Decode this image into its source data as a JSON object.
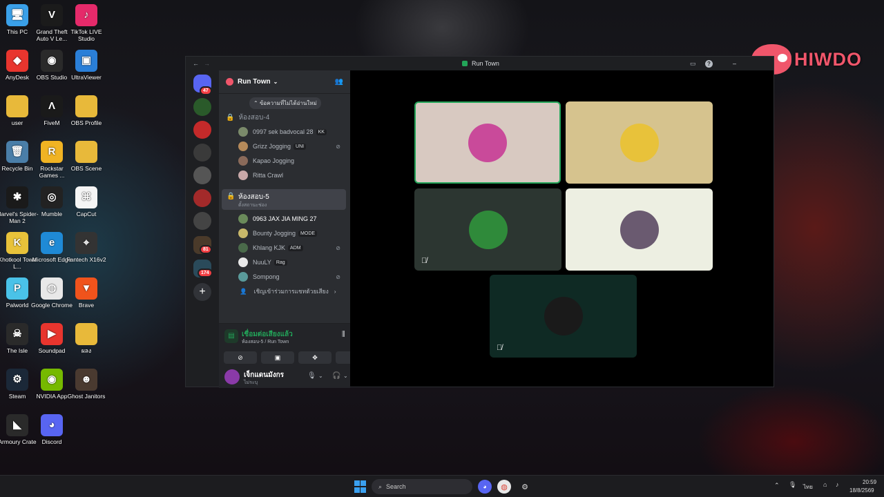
{
  "desktop": {
    "icons": [
      {
        "label": "This PC",
        "color": "#3aa0e8",
        "glyph": "🖥"
      },
      {
        "label": "Grand Theft Auto V Le...",
        "color": "#1b1b1b",
        "glyph": "V"
      },
      {
        "label": "TikTok LIVE Studio",
        "color": "#e52a6a",
        "glyph": "♪"
      },
      {
        "label": "AnyDesk",
        "color": "#e8352e",
        "glyph": "◆"
      },
      {
        "label": "OBS Studio",
        "color": "#2a2a2a",
        "glyph": "◉"
      },
      {
        "label": "UltraViewer",
        "color": "#2a7fd8",
        "glyph": "▣"
      },
      {
        "label": "user",
        "color": "#e8b93a",
        "glyph": ""
      },
      {
        "label": "FiveM",
        "color": "#1a1a1a",
        "glyph": "Λ"
      },
      {
        "label": "OBS Profile",
        "color": "#e8b93a",
        "glyph": ""
      },
      {
        "label": "Recycle Bin",
        "color": "#4a7ea8",
        "glyph": "🗑"
      },
      {
        "label": "Rockstar Games ...",
        "color": "#f0b323",
        "glyph": "R"
      },
      {
        "label": "OBS Scene",
        "color": "#e8b93a",
        "glyph": ""
      },
      {
        "label": "Marvel's Spider-Man 2",
        "color": "#1a1a1a",
        "glyph": "✱"
      },
      {
        "label": "Mumble",
        "color": "#222",
        "glyph": "◎"
      },
      {
        "label": "CapCut",
        "color": "#f5f5f5",
        "glyph": "⌘"
      },
      {
        "label": "Khotkool Town L...",
        "color": "#e8c23a",
        "glyph": "K"
      },
      {
        "label": "Microsoft Edge",
        "color": "#1f8ad6",
        "glyph": "e"
      },
      {
        "label": "Fantech X16v2",
        "color": "#333",
        "glyph": "⌖"
      },
      {
        "label": "Palworld",
        "color": "#4ac2e8",
        "glyph": "P"
      },
      {
        "label": "Google Chrome",
        "color": "#e8e8e8",
        "glyph": "◍"
      },
      {
        "label": "Brave",
        "color": "#f0531c",
        "glyph": "▼"
      },
      {
        "label": "The Isle",
        "color": "#2a2a2a",
        "glyph": "☠"
      },
      {
        "label": "Soundpad",
        "color": "#e8352e",
        "glyph": "▶"
      },
      {
        "label": "ผลง",
        "color": "#e8b93a",
        "glyph": ""
      },
      {
        "label": "Steam",
        "color": "#1b2838",
        "glyph": "⚙"
      },
      {
        "label": "NVIDIA App",
        "color": "#76b900",
        "glyph": "◉"
      },
      {
        "label": "Ghost Janitors",
        "color": "#4a3a30",
        "glyph": "☻"
      },
      {
        "label": "Armoury Crate",
        "color": "#2a2a2a",
        "glyph": "◣"
      },
      {
        "label": "Discord",
        "color": "#5865f2",
        "glyph": "◕"
      }
    ]
  },
  "watermark": {
    "text": "HIWDO"
  },
  "window": {
    "title": "Run Town"
  },
  "guilds": {
    "home_badge": "47",
    "badge_81": "81",
    "badge_174": "174",
    "add_label": "+"
  },
  "server": {
    "name": "Run Town"
  },
  "channels": {
    "unread_tooltip": "ข้อความที่ไม่ได้อ่านใหม่",
    "room4": {
      "name": "ห้องสอบ-4",
      "members": [
        {
          "name": "0997 sek badvocal 28",
          "tag": "KK",
          "mute": false
        },
        {
          "name": "Grizz Jogging",
          "tag": "UNI",
          "mute": true
        },
        {
          "name": "Kapao Jogging",
          "tag": "",
          "mute": false
        },
        {
          "name": "Ritta Crawl",
          "tag": "",
          "mute": false
        }
      ]
    },
    "room5": {
      "name": "ห้องสอบ-5",
      "status": "ตั้งสถานะช่อง",
      "members": [
        {
          "name": "0963 JAX JIA MING 27",
          "tag": "",
          "mute": false
        },
        {
          "name": "Bounty Jogging",
          "tag": "MODE",
          "mute": false
        },
        {
          "name": "Khlang KJK",
          "tag": "ADM",
          "mute": true
        },
        {
          "name": "NuuLY",
          "tag": "Rag",
          "mute": false
        },
        {
          "name": "Sompong",
          "tag": "",
          "mute": true
        }
      ]
    },
    "invite": "เชิญเข้าร่วมการแชทด้วยเสียง"
  },
  "voice": {
    "status": "เชื่อมต่อเสียงแล้ว",
    "location": "ห้องสอบ-5 / Run Town"
  },
  "user": {
    "name": "เจ็กแดนมังกร",
    "status": "ไม่ระบุ"
  },
  "tiles": [
    {
      "bg": "#d8c9c1",
      "avatar": "#c94a9a"
    },
    {
      "bg": "#d6c38e",
      "avatar": "#e8c23a"
    },
    {
      "bg": "#2c3631",
      "avatar": "#2f8a3a"
    },
    {
      "bg": "#edefe2",
      "avatar": "#6a5a70"
    },
    {
      "bg": "#0f2a24",
      "avatar": "#1a1a1a"
    }
  ],
  "taskbar": {
    "search": "Search",
    "time": "20:59",
    "date": "18/8/2569",
    "lang": "ไทย"
  }
}
